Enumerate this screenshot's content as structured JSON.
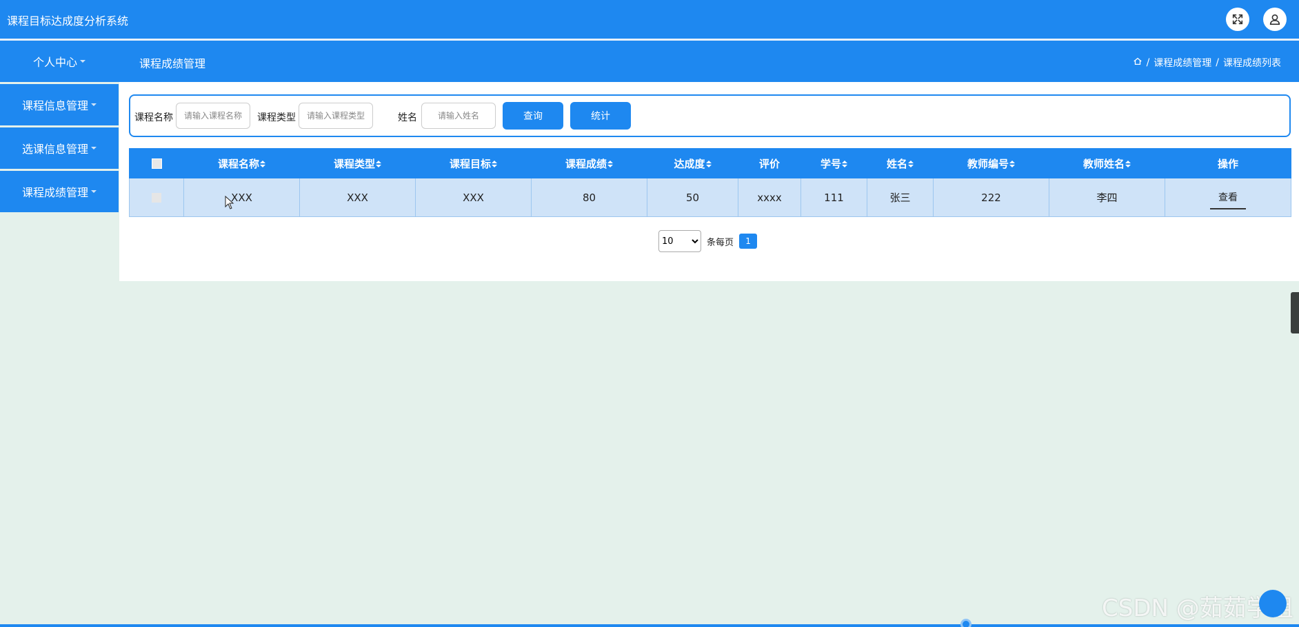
{
  "app": {
    "title": "课程目标达成度分析系统"
  },
  "topbar": {
    "fullscreen_icon": "expand-icon",
    "user_icon": "user-icon"
  },
  "navbar": {
    "personal_center": "个人中心",
    "page_title": "课程成绩管理",
    "breadcrumb": [
      "课程成绩管理",
      "课程成绩列表"
    ],
    "breadcrumb_separator": "/"
  },
  "sidebar": {
    "items": [
      {
        "label": "课程信息管理"
      },
      {
        "label": "选课信息管理"
      },
      {
        "label": "课程成绩管理"
      }
    ]
  },
  "search": {
    "course_name_label": "课程名称",
    "course_name_placeholder": "请输入课程名称",
    "course_type_label": "课程类型",
    "course_type_placeholder": "请输入课程类型",
    "name_label": "姓名",
    "name_placeholder": "请输入姓名",
    "query_button": "查询",
    "stats_button": "统计"
  },
  "table": {
    "headers": [
      "课程名称",
      "课程类型",
      "课程目标",
      "课程成绩",
      "达成度",
      "评价",
      "学号",
      "姓名",
      "教师编号",
      "教师姓名",
      "操作"
    ],
    "rows": [
      {
        "course_name": "XXX",
        "course_type": "XXX",
        "course_goal": "XXX",
        "score": "80",
        "achievement": "50",
        "evaluation": "xxxx",
        "student_id": "111",
        "name": "张三",
        "teacher_id": "222",
        "teacher_name": "李四",
        "action": "查看"
      }
    ]
  },
  "pagination": {
    "page_size": "10",
    "page_size_options": [
      "10"
    ],
    "per_page_label": "条每页",
    "current_page": "1"
  },
  "watermark": "CSDN @茹茹学姐",
  "colors": {
    "primary": "#1e88f0",
    "row_bg": "#cfe3f8",
    "page_bg": "#e4f1eb"
  }
}
